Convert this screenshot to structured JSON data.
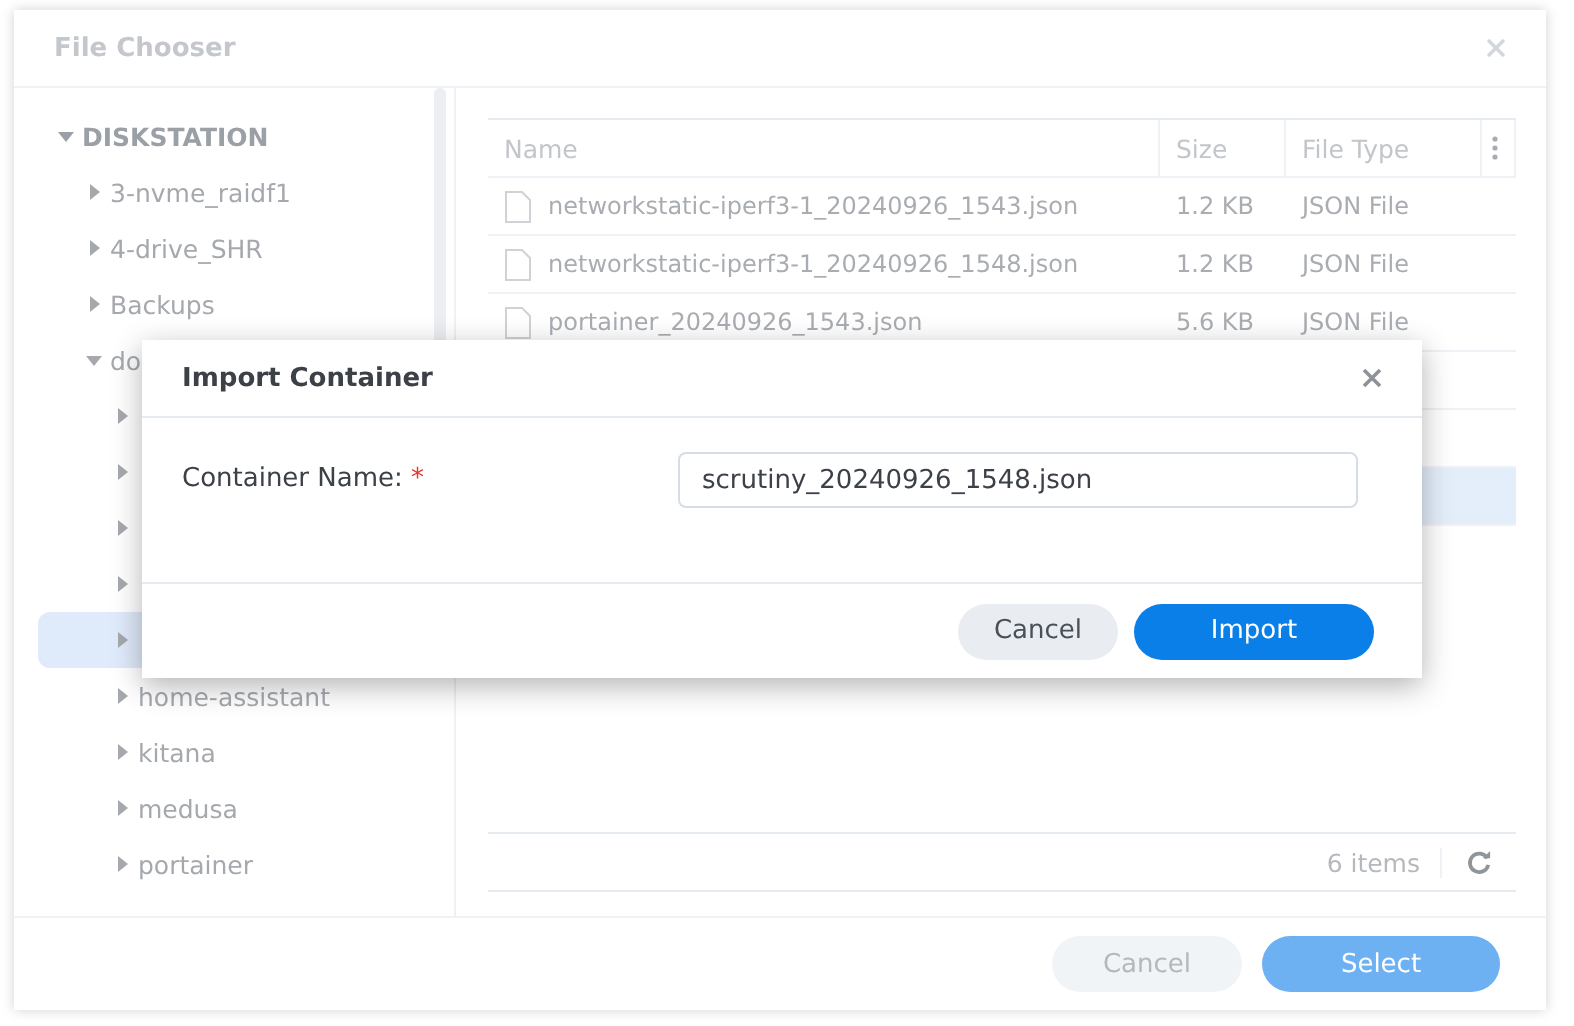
{
  "window": {
    "title": "File Chooser"
  },
  "tree": {
    "root": {
      "label": "DISKSTATION",
      "expanded": true,
      "children": [
        {
          "label": "3-nvme_raidf1",
          "expanded": false,
          "selected": false
        },
        {
          "label": "4-drive_SHR",
          "expanded": false,
          "selected": false
        },
        {
          "label": "Backups",
          "expanded": false,
          "selected": false
        },
        {
          "label": "do",
          "expanded": true,
          "selected": false,
          "children": [
            {
              "expanded": false,
              "selected": false
            },
            {
              "expanded": false,
              "selected": false
            },
            {
              "expanded": false,
              "selected": false
            },
            {
              "expanded": false,
              "selected": false
            },
            {
              "expanded": false,
              "selected": true
            },
            {
              "label": "home-assistant",
              "expanded": false,
              "selected": false
            },
            {
              "label": "kitana",
              "expanded": false,
              "selected": false
            },
            {
              "label": "medusa",
              "expanded": false,
              "selected": false
            },
            {
              "label": "portainer",
              "expanded": false,
              "selected": false
            }
          ]
        }
      ]
    }
  },
  "table": {
    "columns": [
      "Name",
      "Size",
      "File Type"
    ],
    "rows": [
      {
        "name": "networkstatic-iperf3-1_20240926_1543.json",
        "size": "1.2 KB",
        "file_type": "JSON File",
        "selected": false
      },
      {
        "name": "networkstatic-iperf3-1_20240926_1548.json",
        "size": "1.2 KB",
        "file_type": "JSON File",
        "selected": false
      },
      {
        "name": "portainer_20240926_1543.json",
        "size": "5.6 KB",
        "file_type": "JSON File",
        "selected": false
      },
      {
        "selected": false
      },
      {
        "selected": false
      },
      {
        "selected": true
      }
    ],
    "count": "6 items"
  },
  "buttons": [
    {
      "label": "Cancel",
      "kind": "secondary"
    },
    {
      "label": "Select",
      "kind": "primary"
    }
  ],
  "modal": {
    "title": "Import Container",
    "field": {
      "label": "Container Name:",
      "required_mark": "*",
      "value": "scrutiny_20240926_1548.json"
    },
    "buttons": [
      {
        "label": "Cancel",
        "kind": "secondary"
      },
      {
        "label": "Import",
        "kind": "primary"
      }
    ]
  }
}
